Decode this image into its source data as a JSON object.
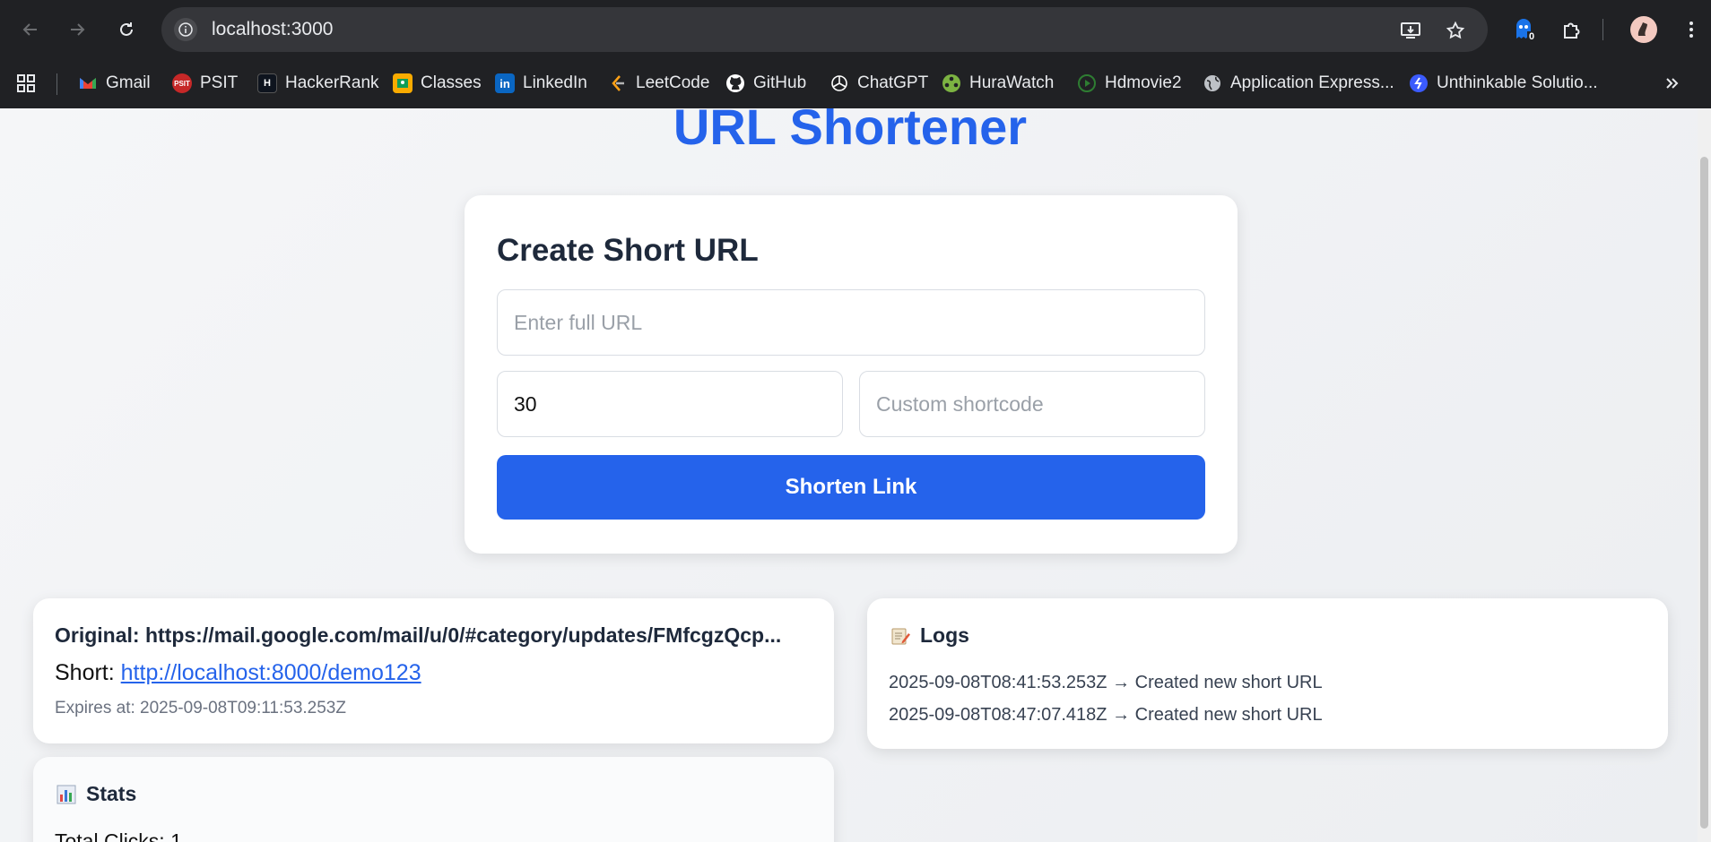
{
  "browser": {
    "url": "localhost:3000",
    "extension_badge": "0",
    "bookmarks": [
      {
        "label": "Gmail",
        "icon": "gmail-icon",
        "color": "#ea4335"
      },
      {
        "label": "PSIT",
        "icon": "psit-icon",
        "color": "#c62828"
      },
      {
        "label": "HackerRank",
        "icon": "hackerrank-icon",
        "color": "#0e141e"
      },
      {
        "label": "Classes",
        "icon": "classes-icon",
        "color": "#f9ab00"
      },
      {
        "label": "LinkedIn",
        "icon": "linkedin-icon",
        "color": "#0a66c2"
      },
      {
        "label": "LeetCode",
        "icon": "leetcode-icon",
        "color": "#ffa116"
      },
      {
        "label": "GitHub",
        "icon": "github-icon",
        "color": "#ffffff"
      },
      {
        "label": "ChatGPT",
        "icon": "chatgpt-icon",
        "color": "#ffffff"
      },
      {
        "label": "HuraWatch",
        "icon": "hurawatch-icon",
        "color": "#7cb342"
      },
      {
        "label": "Hdmovie2",
        "icon": "hdmovie2-icon",
        "color": "#2e7d32"
      },
      {
        "label": "Application Express...",
        "icon": "globe-icon",
        "color": "#bdc1c6"
      },
      {
        "label": "Unthinkable Solutio...",
        "icon": "unthinkable-icon",
        "color": "#3b5bfd"
      }
    ]
  },
  "page": {
    "title": "URL Shortener",
    "accent": "#2563eb"
  },
  "form": {
    "heading": "Create Short URL",
    "url_placeholder": "Enter full URL",
    "validity_value": "30",
    "shortcode_placeholder": "Custom shortcode",
    "submit_label": "Shorten Link"
  },
  "result": {
    "original": "Original: https://mail.google.com/mail/u/0/#category/updates/FMfcgzQcp...",
    "short_label": "Short:",
    "short_url": "http://localhost:8000/demo123",
    "expires": "Expires at: 2025-09-08T09:11:53.253Z"
  },
  "logs": {
    "icon": "memo-icon",
    "title": "Logs",
    "entries": [
      "2025-09-08T08:41:53.253Z → Created new short URL",
      "2025-09-08T08:47:07.418Z → Created new short URL"
    ]
  },
  "stats": {
    "icon": "bar-chart-icon",
    "title": "Stats",
    "total_clicks": "Total Clicks: 1"
  }
}
